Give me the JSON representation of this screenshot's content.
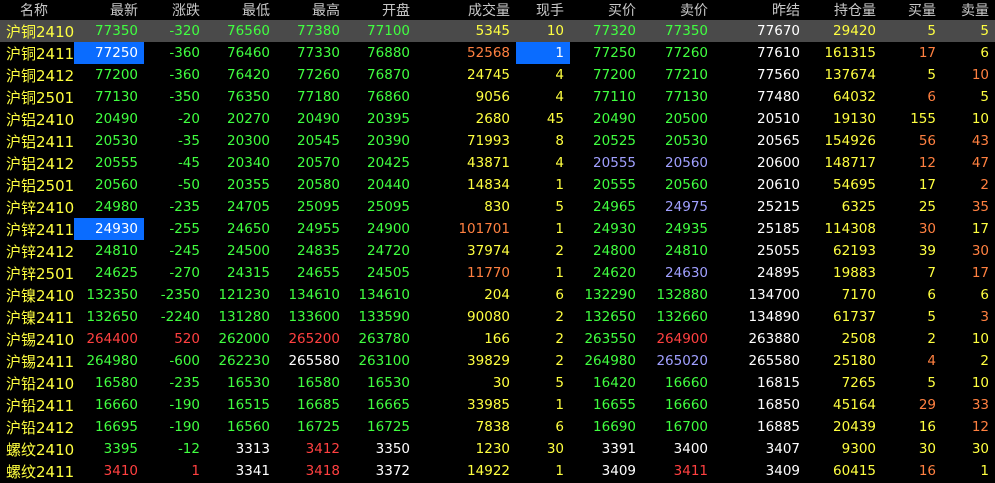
{
  "headers": [
    "名称",
    "最新",
    "涨跌",
    "最低",
    "最高",
    "开盘",
    "成交量",
    "现手",
    "买价",
    "卖价",
    "昨结",
    "持仓量",
    "买量",
    "卖量"
  ],
  "rows": [
    [
      "沪铜2410",
      "77350",
      "-320",
      "76560",
      "77380",
      "77100",
      "5345",
      "10",
      "77320",
      "77350",
      "77670",
      "29420",
      "5",
      "5"
    ],
    [
      "沪铜2411",
      "77250",
      "-360",
      "76460",
      "77330",
      "76880",
      "52568",
      "1",
      "77250",
      "77260",
      "77610",
      "161315",
      "17",
      "6"
    ],
    [
      "沪铜2412",
      "77200",
      "-360",
      "76420",
      "77260",
      "76870",
      "24745",
      "4",
      "77200",
      "77210",
      "77560",
      "137674",
      "5",
      "10"
    ],
    [
      "沪铜2501",
      "77130",
      "-350",
      "76350",
      "77180",
      "76860",
      "9056",
      "4",
      "77110",
      "77130",
      "77480",
      "64032",
      "6",
      "5"
    ],
    [
      "沪铝2410",
      "20490",
      "-20",
      "20270",
      "20490",
      "20395",
      "2680",
      "45",
      "20490",
      "20500",
      "20510",
      "19130",
      "155",
      "10"
    ],
    [
      "沪铝2411",
      "20530",
      "-35",
      "20300",
      "20545",
      "20390",
      "71993",
      "8",
      "20525",
      "20530",
      "20565",
      "154926",
      "56",
      "43"
    ],
    [
      "沪铝2412",
      "20555",
      "-45",
      "20340",
      "20570",
      "20425",
      "43871",
      "4",
      "20555",
      "20560",
      "20600",
      "148717",
      "12",
      "47"
    ],
    [
      "沪铝2501",
      "20560",
      "-50",
      "20355",
      "20580",
      "20440",
      "14834",
      "1",
      "20555",
      "20560",
      "20610",
      "54695",
      "17",
      "2"
    ],
    [
      "沪锌2410",
      "24980",
      "-235",
      "24705",
      "25095",
      "25095",
      "830",
      "5",
      "24965",
      "24975",
      "25215",
      "6325",
      "25",
      "35"
    ],
    [
      "沪锌2411",
      "24930",
      "-255",
      "24650",
      "24955",
      "24900",
      "101701",
      "1",
      "24930",
      "24935",
      "25185",
      "114308",
      "30",
      "17"
    ],
    [
      "沪锌2412",
      "24810",
      "-245",
      "24500",
      "24835",
      "24720",
      "37974",
      "2",
      "24800",
      "24810",
      "25055",
      "62193",
      "39",
      "30"
    ],
    [
      "沪锌2501",
      "24625",
      "-270",
      "24315",
      "24655",
      "24505",
      "11770",
      "1",
      "24620",
      "24630",
      "24895",
      "19883",
      "7",
      "17"
    ],
    [
      "沪镍2410",
      "132350",
      "-2350",
      "121230",
      "134610",
      "134610",
      "204",
      "6",
      "132290",
      "132880",
      "134700",
      "7170",
      "6",
      "6"
    ],
    [
      "沪镍2411",
      "132650",
      "-2240",
      "131280",
      "133600",
      "133590",
      "90080",
      "2",
      "132650",
      "132660",
      "134890",
      "61737",
      "5",
      "3"
    ],
    [
      "沪锡2410",
      "264400",
      "520",
      "262000",
      "265200",
      "263780",
      "166",
      "2",
      "263550",
      "264900",
      "263880",
      "2508",
      "2",
      "10"
    ],
    [
      "沪锡2411",
      "264980",
      "-600",
      "262230",
      "265580",
      "263100",
      "39829",
      "2",
      "264980",
      "265020",
      "265580",
      "25180",
      "4",
      "2"
    ],
    [
      "沪铅2410",
      "16580",
      "-235",
      "16530",
      "16580",
      "16530",
      "30",
      "5",
      "16420",
      "16660",
      "16815",
      "7265",
      "5",
      "10"
    ],
    [
      "沪铅2411",
      "16660",
      "-190",
      "16515",
      "16685",
      "16665",
      "33985",
      "1",
      "16655",
      "16660",
      "16850",
      "45164",
      "29",
      "33"
    ],
    [
      "沪铅2412",
      "16695",
      "-190",
      "16560",
      "16725",
      "16725",
      "7838",
      "6",
      "16690",
      "16700",
      "16885",
      "20439",
      "16",
      "12"
    ],
    [
      "螺纹2410",
      "3395",
      "-12",
      "3313",
      "3412",
      "3350",
      "1230",
      "30",
      "3391",
      "3400",
      "3407",
      "9300",
      "30",
      "30"
    ],
    [
      "螺纹2411",
      "3410",
      "1",
      "3341",
      "3418",
      "3372",
      "14922",
      "1",
      "3409",
      "3411",
      "3409",
      "60415",
      "16",
      "1"
    ]
  ],
  "colors": [
    [
      "y",
      "g",
      "g",
      "g",
      "g",
      "g",
      "y",
      "y",
      "g",
      "g",
      "w",
      "y",
      "y",
      "y"
    ],
    [
      "y",
      "g",
      "g",
      "g",
      "g",
      "g",
      "o",
      "w",
      "g",
      "g",
      "w",
      "y",
      "o",
      "y"
    ],
    [
      "y",
      "g",
      "g",
      "g",
      "g",
      "g",
      "y",
      "y",
      "g",
      "g",
      "w",
      "y",
      "y",
      "o"
    ],
    [
      "y",
      "g",
      "g",
      "g",
      "g",
      "g",
      "y",
      "y",
      "g",
      "g",
      "w",
      "y",
      "o",
      "y"
    ],
    [
      "y",
      "g",
      "g",
      "g",
      "g",
      "g",
      "y",
      "y",
      "g",
      "g",
      "w",
      "y",
      "y",
      "y"
    ],
    [
      "y",
      "g",
      "g",
      "g",
      "g",
      "g",
      "y",
      "y",
      "g",
      "g",
      "w",
      "y",
      "o",
      "o"
    ],
    [
      "y",
      "g",
      "g",
      "g",
      "g",
      "g",
      "y",
      "y",
      "b",
      "b",
      "w",
      "y",
      "o",
      "o"
    ],
    [
      "y",
      "g",
      "g",
      "g",
      "g",
      "g",
      "y",
      "y",
      "g",
      "g",
      "w",
      "y",
      "y",
      "o"
    ],
    [
      "y",
      "g",
      "g",
      "g",
      "g",
      "g",
      "y",
      "y",
      "g",
      "b",
      "w",
      "y",
      "y",
      "o"
    ],
    [
      "y",
      "g",
      "g",
      "g",
      "g",
      "g",
      "o",
      "y",
      "g",
      "g",
      "w",
      "y",
      "o",
      "y"
    ],
    [
      "y",
      "g",
      "g",
      "g",
      "g",
      "g",
      "y",
      "y",
      "g",
      "g",
      "w",
      "y",
      "y",
      "o"
    ],
    [
      "y",
      "g",
      "g",
      "g",
      "g",
      "g",
      "o",
      "y",
      "g",
      "b",
      "w",
      "y",
      "y",
      "o"
    ],
    [
      "y",
      "g",
      "g",
      "g",
      "g",
      "g",
      "y",
      "y",
      "g",
      "g",
      "w",
      "y",
      "y",
      "y"
    ],
    [
      "y",
      "g",
      "g",
      "g",
      "g",
      "g",
      "y",
      "y",
      "g",
      "g",
      "w",
      "y",
      "y",
      "o"
    ],
    [
      "y",
      "r",
      "r",
      "g",
      "r",
      "g",
      "y",
      "y",
      "g",
      "r",
      "w",
      "y",
      "y",
      "y"
    ],
    [
      "y",
      "g",
      "g",
      "g",
      "w",
      "g",
      "y",
      "y",
      "g",
      "b",
      "w",
      "y",
      "o",
      "y"
    ],
    [
      "y",
      "g",
      "g",
      "g",
      "g",
      "g",
      "y",
      "y",
      "g",
      "g",
      "w",
      "y",
      "y",
      "y"
    ],
    [
      "y",
      "g",
      "g",
      "g",
      "g",
      "g",
      "y",
      "y",
      "g",
      "g",
      "w",
      "y",
      "o",
      "o"
    ],
    [
      "y",
      "g",
      "g",
      "g",
      "g",
      "g",
      "y",
      "y",
      "g",
      "g",
      "w",
      "y",
      "y",
      "o"
    ],
    [
      "y",
      "g",
      "g",
      "w",
      "r",
      "w",
      "y",
      "y",
      "w",
      "w",
      "w",
      "y",
      "y",
      "y"
    ],
    [
      "y",
      "r",
      "r",
      "w",
      "r",
      "w",
      "y",
      "y",
      "w",
      "r",
      "w",
      "y",
      "o",
      "y"
    ]
  ],
  "selected_row": 0,
  "highlight_cells": [
    [
      1,
      1
    ],
    [
      1,
      7
    ],
    [
      9,
      1
    ]
  ]
}
